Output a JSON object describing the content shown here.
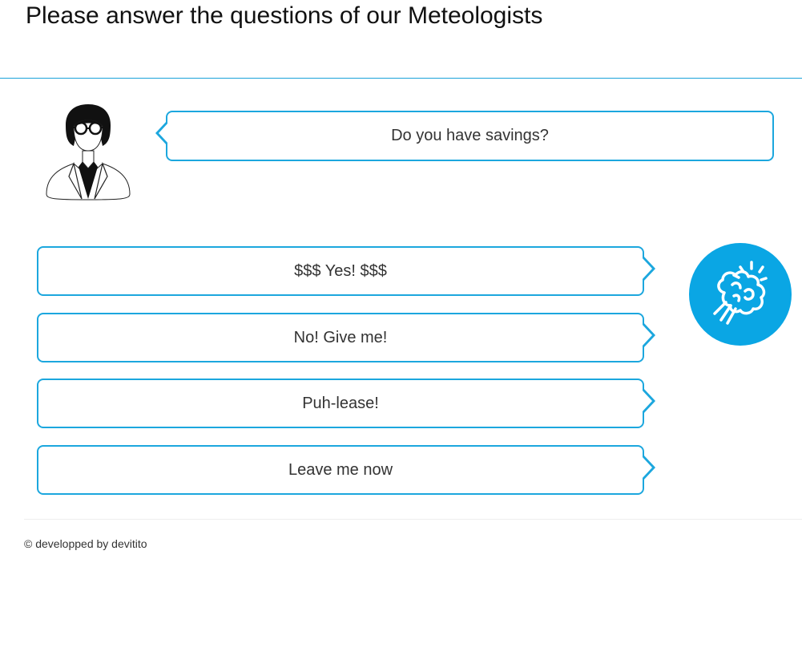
{
  "header": {
    "title": "Please answer the questions of our Meteologists"
  },
  "conversation": {
    "avatar_icon": "meteorologist-avatar-icon",
    "question": "Do you have savings?",
    "answers": [
      {
        "label": "$$$ Yes! $$$"
      },
      {
        "label": "No! Give me!"
      },
      {
        "label": "Puh-lease!"
      },
      {
        "label": "Leave me now"
      }
    ],
    "bot_icon": "weather-brain-icon"
  },
  "footer": {
    "text": "© developped by devitito"
  },
  "colors": {
    "accent": "#1ca7de",
    "logo_background": "#0aa6e4"
  }
}
